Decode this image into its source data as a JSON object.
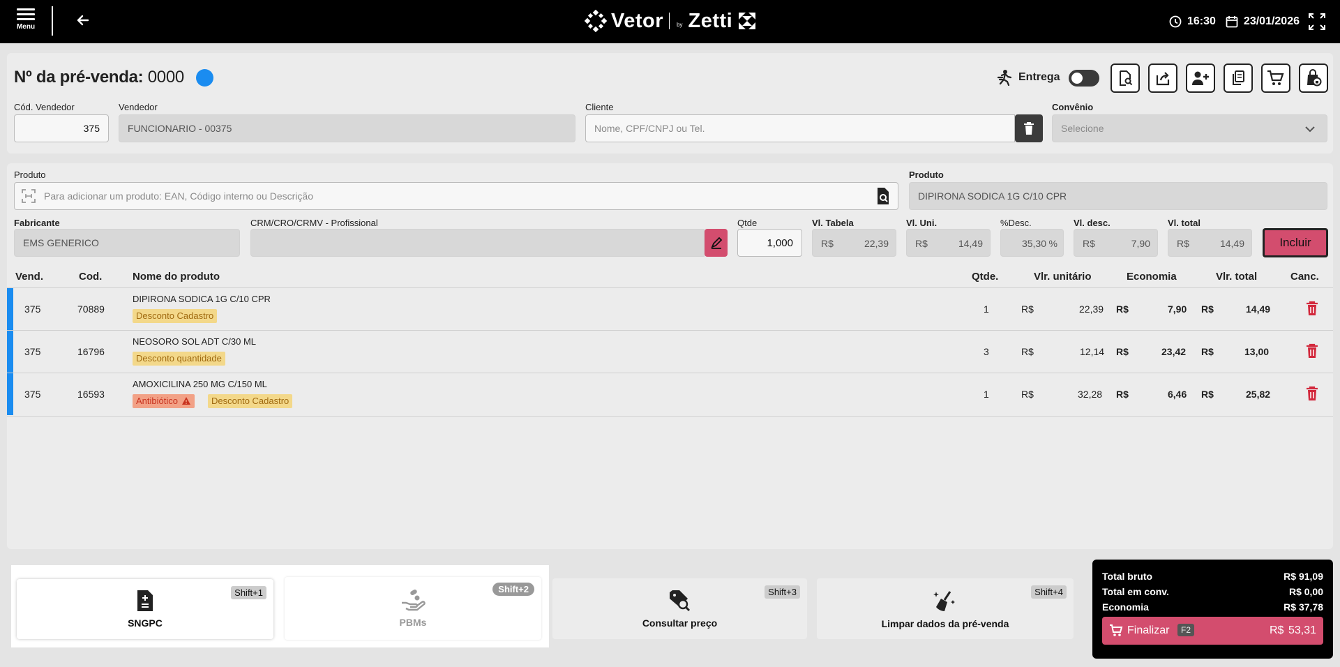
{
  "topbar": {
    "menu_label": "Menu",
    "logo_left": "Vetor",
    "logo_by": "by",
    "logo_right": "Zetti",
    "time": "16:30",
    "date": "23/01/2026"
  },
  "header": {
    "title_label": "Nº da pré-venda:",
    "title_number": "0000",
    "entrega_label": "Entrega",
    "entrega_on": false
  },
  "seller": {
    "cod_label": "Cód. Vendedor",
    "cod_value": "375",
    "name_label": "Vendedor",
    "name_value": "FUNCIONARIO - 00375"
  },
  "client": {
    "label": "Cliente",
    "placeholder": "Nome, CPF/CNPJ ou Tel."
  },
  "convenio": {
    "label": "Convênio",
    "selected": "Selecione"
  },
  "product_entry": {
    "search_label": "Produto",
    "search_placeholder": "Para adicionar um produto: EAN, Código interno ou Descrição",
    "product_label": "Produto",
    "product_value": "DIPIRONA SODICA 1G C/10 CPR",
    "fabricante_label": "Fabricante",
    "fabricante_value": "EMS GENERICO",
    "crm_label": "CRM/CRO/CRMV - Profissional",
    "crm_value": "",
    "qtde_label": "Qtde",
    "qtde_value": "1,000",
    "vl_tabela_label": "Vl. Tabela",
    "vl_tabela_cur": "R$",
    "vl_tabela_value": "22,39",
    "vl_uni_label": "Vl. Uni.",
    "vl_uni_cur": "R$",
    "vl_uni_value": "14,49",
    "desc_pct_label": "%Desc.",
    "desc_pct_value": "35,30",
    "desc_pct_unit": "%",
    "vl_desc_label": "Vl. desc.",
    "vl_desc_cur": "R$",
    "vl_desc_value": "7,90",
    "vl_total_label": "Vl. total",
    "vl_total_cur": "R$",
    "vl_total_value": "14,49",
    "incluir_label": "Incluir"
  },
  "table": {
    "headers": {
      "vend": "Vend.",
      "cod": "Cod.",
      "nome": "Nome do produto",
      "qtde": "Qtde.",
      "vlr_unit": "Vlr. unitário",
      "economia": "Economia",
      "vlr_total": "Vlr. total",
      "canc": "Canc."
    },
    "currency": "R$",
    "rows": [
      {
        "vend": "375",
        "cod": "70889",
        "nome": "DIPIRONA SODICA 1G C/10 CPR",
        "tags": [
          {
            "text": "Desconto Cadastro",
            "kind": "yellow"
          }
        ],
        "qtde": "1",
        "vlr_unit": "22,39",
        "economia": "7,90",
        "vlr_total": "14,49"
      },
      {
        "vend": "375",
        "cod": "16796",
        "nome": "NEOSORO SOL ADT C/30 ML",
        "tags": [
          {
            "text": "Desconto quantidade",
            "kind": "yellow"
          }
        ],
        "qtde": "3",
        "vlr_unit": "12,14",
        "economia": "23,42",
        "vlr_total": "13,00"
      },
      {
        "vend": "375",
        "cod": "16593",
        "nome": "AMOXICILINA 250 MG C/150 ML",
        "tags": [
          {
            "text": "Antibiótico",
            "kind": "orange"
          },
          {
            "text": "Desconto Cadastro",
            "kind": "yellow"
          }
        ],
        "qtde": "1",
        "vlr_unit": "32,28",
        "economia": "6,46",
        "vlr_total": "25,82"
      }
    ]
  },
  "shortcuts": [
    {
      "label": "SNGPC",
      "key": "Shift+1",
      "icon": "document-plus-icon"
    },
    {
      "label": "PBMs",
      "key": "Shift+2",
      "icon": "hand-pills-icon"
    },
    {
      "label": "Consultar preço",
      "key": "Shift+3",
      "icon": "price-tag-search-icon"
    },
    {
      "label": "Limpar dados da pré-venda",
      "key": "Shift+4",
      "icon": "broom-icon"
    }
  ],
  "totals": {
    "bruto_label": "Total bruto",
    "bruto_value": "R$ 91,09",
    "conv_label": "Total em conv.",
    "conv_value": "R$ 0,00",
    "economia_label": "Economia",
    "economia_value": "R$ 37,78",
    "finalizar_label": "Finalizar",
    "finalizar_key": "F2",
    "finalizar_cur": "R$",
    "finalizar_value": "53,31"
  },
  "colors": {
    "accent_blue": "#1a8cf0",
    "action_pink": "#d34d6e",
    "tag_yellow": "#f3d88a",
    "tag_orange": "#f2a186",
    "delete_red": "#d2283c"
  }
}
